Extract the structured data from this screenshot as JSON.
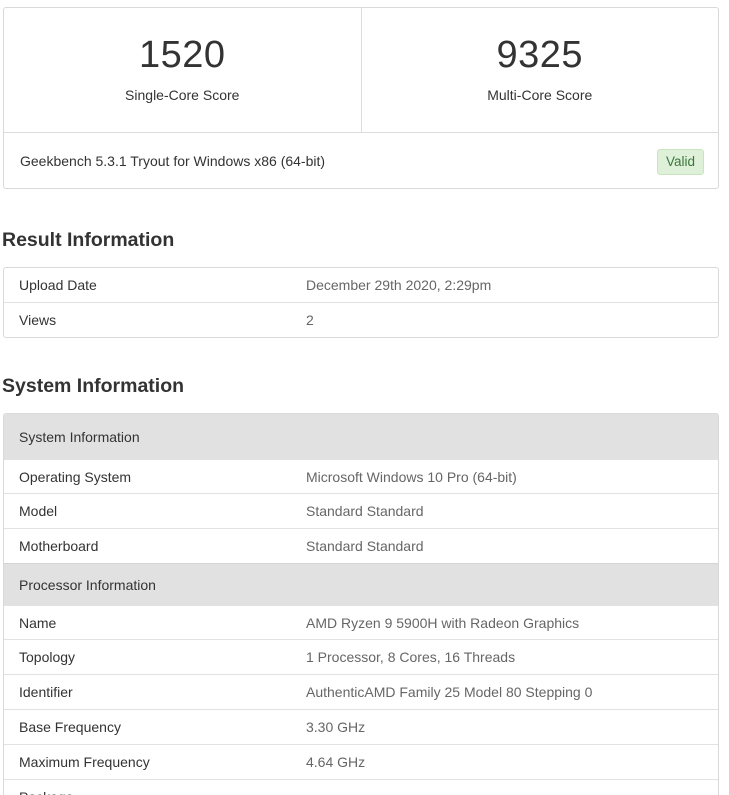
{
  "scores": {
    "single_core": {
      "value": "1520",
      "label": "Single-Core Score"
    },
    "multi_core": {
      "value": "9325",
      "label": "Multi-Core Score"
    }
  },
  "version": {
    "text": "Geekbench 5.3.1 Tryout for Windows x86 (64-bit)",
    "badge": "Valid",
    "badge_color": "#dff0d8"
  },
  "result_information": {
    "title": "Result Information",
    "rows": [
      {
        "name": "Upload Date",
        "value": "December 29th 2020, 2:29pm"
      },
      {
        "name": "Views",
        "value": "2"
      }
    ]
  },
  "system_information": {
    "title": "System Information",
    "groups": [
      {
        "header": "System Information",
        "rows": [
          {
            "name": "Operating System",
            "value": "Microsoft Windows 10 Pro (64-bit)"
          },
          {
            "name": "Model",
            "value": "Standard Standard"
          },
          {
            "name": "Motherboard",
            "value": "Standard Standard"
          }
        ]
      },
      {
        "header": "Processor Information",
        "rows": [
          {
            "name": "Name",
            "value": "AMD Ryzen 9 5900H with Radeon Graphics"
          },
          {
            "name": "Topology",
            "value": "1 Processor, 8 Cores, 16 Threads"
          },
          {
            "name": "Identifier",
            "value": "AuthenticAMD Family 25 Model 80 Stepping 0"
          },
          {
            "name": "Base Frequency",
            "value": "3.30 GHz"
          },
          {
            "name": "Maximum Frequency",
            "value": "4.64 GHz"
          },
          {
            "name": "Package",
            "value": ""
          }
        ]
      }
    ]
  }
}
